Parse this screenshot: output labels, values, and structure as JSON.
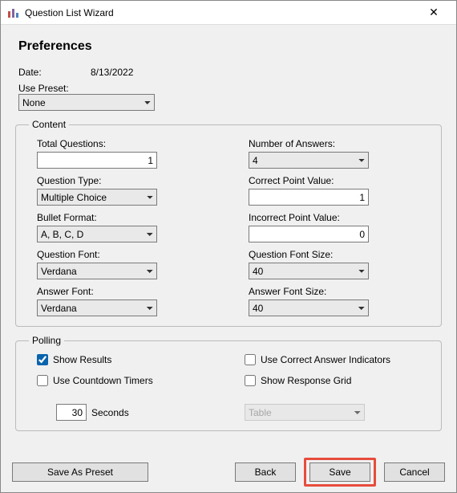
{
  "window": {
    "title": "Question List Wizard",
    "close_glyph": "✕"
  },
  "heading": "Preferences",
  "date_label": "Date:",
  "date_value": "8/13/2022",
  "preset_label": "Use Preset:",
  "preset_value": "None",
  "content": {
    "legend": "Content",
    "total_questions_label": "Total Questions:",
    "total_questions_value": "1",
    "number_answers_label": "Number of Answers:",
    "number_answers_value": "4",
    "question_type_label": "Question Type:",
    "question_type_value": "Multiple Choice",
    "correct_pts_label": "Correct Point Value:",
    "correct_pts_value": "1",
    "bullet_format_label": "Bullet Format:",
    "bullet_format_value": "A, B, C, D",
    "incorrect_pts_label": "Incorrect Point Value:",
    "incorrect_pts_value": "0",
    "question_font_label": "Question Font:",
    "question_font_value": "Verdana",
    "question_font_size_label": "Question Font Size:",
    "question_font_size_value": "40",
    "answer_font_label": "Answer Font:",
    "answer_font_value": "Verdana",
    "answer_font_size_label": "Answer Font Size:",
    "answer_font_size_value": "40"
  },
  "polling": {
    "legend": "Polling",
    "show_results_label": "Show Results",
    "show_results_checked": true,
    "use_correct_indicators_label": "Use Correct Answer Indicators",
    "use_correct_indicators_checked": false,
    "use_countdown_label": "Use Countdown Timers",
    "use_countdown_checked": false,
    "show_response_grid_label": "Show Response Grid",
    "show_response_grid_checked": false,
    "seconds_value": "30",
    "seconds_label": "Seconds",
    "grid_type_value": "Table"
  },
  "buttons": {
    "save_preset": "Save As Preset",
    "back": "Back",
    "save": "Save",
    "cancel": "Cancel"
  },
  "colors": {
    "highlight": "#e74c3c"
  }
}
